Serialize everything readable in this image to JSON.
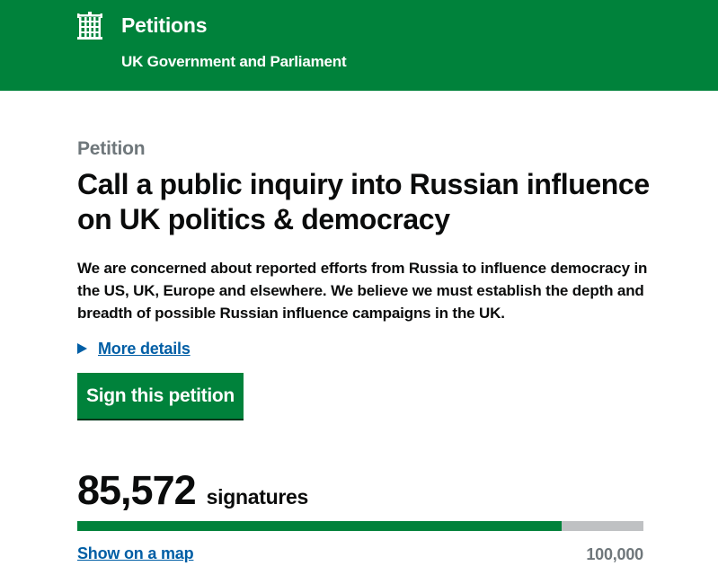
{
  "header": {
    "crest_icon": "portcullis-icon",
    "site_title": "Petitions",
    "site_subtitle": "UK Government and Parliament",
    "background_color": "#00823b"
  },
  "petition": {
    "caption": "Petition",
    "title": "Call a public inquiry into Russian influence on UK politics & democracy",
    "summary": "We are concerned about reported efforts from Russia to influence democracy in the US, UK, Europe and elsewhere. We believe we must establish the depth and breadth of possible Russian influence campaigns in the UK.",
    "more_details_label": "More details",
    "sign_button_label": "Sign this petition"
  },
  "signatures": {
    "count": "85,572",
    "label": "signatures",
    "target": "100,000",
    "progress_fraction": 0.85572,
    "map_link_label": "Show on a map"
  },
  "colors": {
    "accent_green": "#00823b",
    "link_blue": "#005ea5",
    "muted_grey": "#6f777b",
    "progress_track": "#bfc1c3"
  }
}
